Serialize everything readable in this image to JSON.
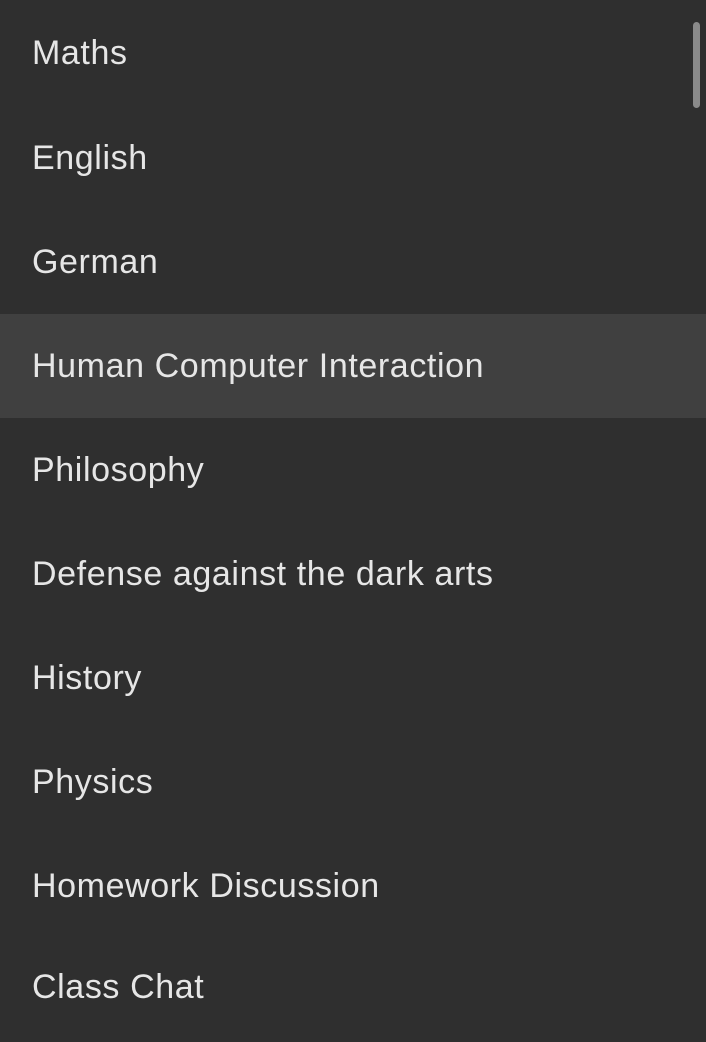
{
  "menu": {
    "items": [
      {
        "label": "Maths"
      },
      {
        "label": "English"
      },
      {
        "label": "German"
      },
      {
        "label": "Human Computer Interaction",
        "highlighted": true
      },
      {
        "label": "Philosophy"
      },
      {
        "label": "Defense against the dark arts"
      },
      {
        "label": "History"
      },
      {
        "label": "Physics"
      },
      {
        "label": "Homework Discussion"
      },
      {
        "label": "Class Chat"
      }
    ]
  },
  "colors": {
    "background": "#2f2f2f",
    "highlight": "#404040",
    "text": "#e6e6e6",
    "scrollbar": "#8a8a8a"
  }
}
